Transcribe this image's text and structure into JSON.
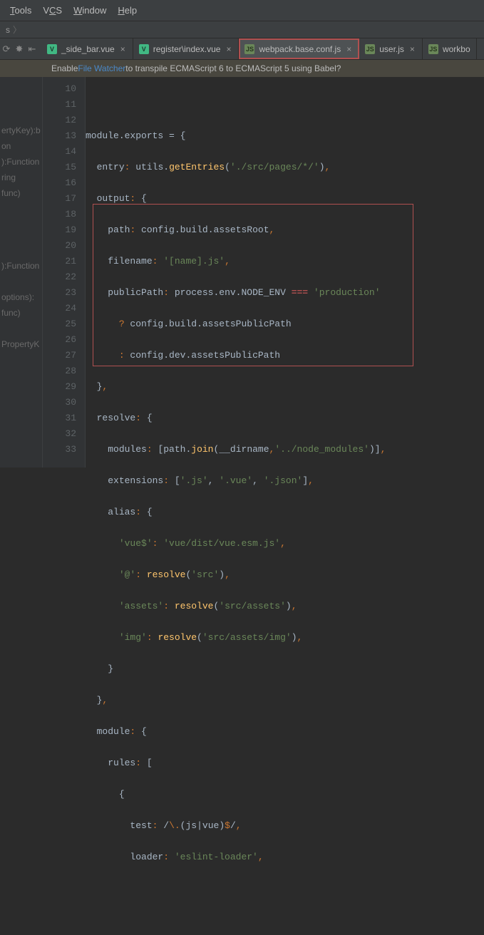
{
  "menu": {
    "tools": "Tools",
    "vcs": "VCS",
    "window": "Window",
    "help": "Help"
  },
  "breadcrumb": {
    "last": "s"
  },
  "toolbar_icons": {
    "sync": "⟳",
    "gear": "✸",
    "collapse": "⇤"
  },
  "tabs": [
    {
      "label": "_side_bar.vue",
      "kind": "vue"
    },
    {
      "label": "register\\index.vue",
      "kind": "vue"
    },
    {
      "label": "webpack.base.conf.js",
      "kind": "js"
    },
    {
      "label": "user.js",
      "kind": "js"
    },
    {
      "label": "workbo",
      "kind": "js"
    }
  ],
  "banner": {
    "pre": "Enable ",
    "link": "File Watcher",
    "post": " to transpile ECMAScript 6 to ECMAScript 5 using Babel?"
  },
  "first_line": 10,
  "last_line": 33,
  "code": {
    "l10": {
      "a": "module",
      "b": ".",
      "c": "exports",
      "d": " = ",
      "e": "{"
    },
    "l11": {
      "a": "entry",
      "b": ": ",
      "c": "utils",
      "d": ".",
      "e": "getEntries",
      "f": "(",
      "g": "'./src/pages/*/'",
      "h": ")",
      "i": ","
    },
    "l12": {
      "a": "output",
      "b": ": ",
      "c": "{"
    },
    "l13": {
      "a": "path",
      "b": ": ",
      "c": "config",
      "d": ".",
      "e": "build",
      "f": ".",
      "g": "assetsRoot",
      "h": ","
    },
    "l14": {
      "a": "filename",
      "b": ": ",
      "c": "'[name].js'",
      "d": ","
    },
    "l15": {
      "a": "publicPath",
      "b": ": ",
      "c": "process",
      "d": ".",
      "e": "env",
      "f": ".",
      "g": "NODE_ENV",
      "h": " === ",
      "i": "'production'"
    },
    "l16": {
      "a": "? ",
      "b": "config",
      "c": ".",
      "d": "build",
      "e": ".",
      "f": "assetsPublicPath"
    },
    "l17": {
      "a": ": ",
      "b": "config",
      "c": ".",
      "d": "dev",
      "e": ".",
      "f": "assetsPublicPath"
    },
    "l18": {
      "a": "}",
      "b": ","
    },
    "l19": {
      "a": "resolve",
      "b": ": ",
      "c": "{"
    },
    "l20": {
      "a": "modules",
      "b": ": ",
      "c": "[",
      "d": "path",
      "e": ".",
      "f": "join",
      "g": "(",
      "h": "__dirname",
      "i": ",",
      "j": "'../node_modules'",
      "k": ")]",
      "l": ","
    },
    "l21": {
      "a": "extensions",
      "b": ": ",
      "c": "[",
      "d": "'.js'",
      "e": ", ",
      "f": "'.vue'",
      "g": ", ",
      "h": "'.json'",
      "i": "]",
      "j": ","
    },
    "l22": {
      "a": "alias",
      "b": ": ",
      "c": "{"
    },
    "l23": {
      "a": "'vue$'",
      "b": ": ",
      "c": "'vue/dist/vue.esm.js'",
      "d": ","
    },
    "l24": {
      "a": "'@'",
      "b": ": ",
      "c": "resolve",
      "d": "(",
      "e": "'src'",
      "f": ")",
      "g": ","
    },
    "l25": {
      "a": "'assets'",
      "b": ": ",
      "c": "resolve",
      "d": "(",
      "e": "'src/assets'",
      "f": ")",
      "g": ","
    },
    "l26": {
      "a": "'img'",
      "b": ": ",
      "c": "resolve",
      "d": "(",
      "e": "'src/assets/img'",
      "f": ")",
      "g": ","
    },
    "l27": {
      "a": "}"
    },
    "l28": {
      "a": "}",
      "b": ","
    },
    "l29": {
      "a": "module",
      "b": ": ",
      "c": "{"
    },
    "l30": {
      "a": "rules",
      "b": ": ",
      "c": "["
    },
    "l31": {
      "a": "{"
    },
    "l32": {
      "a": "test",
      "b": ": ",
      "c": "/",
      "d": "\\.",
      "e": "(",
      "f": "js",
      "g": "|",
      "h": "vue",
      "i": ")",
      "j": "$",
      "k": "/",
      "l": ","
    },
    "l33": {
      "a": "loader",
      "b": ": ",
      "c": "'eslint-loader'",
      "d": ","
    }
  },
  "ghost": {
    "g1": "ertyKey):b",
    "g2": "on",
    "g3": "):Function",
    "g4": "ring",
    "g5": "func)",
    "g6": "):Function",
    "g7": " options):",
    "g8": " func)",
    "g9": "PropertyK"
  }
}
